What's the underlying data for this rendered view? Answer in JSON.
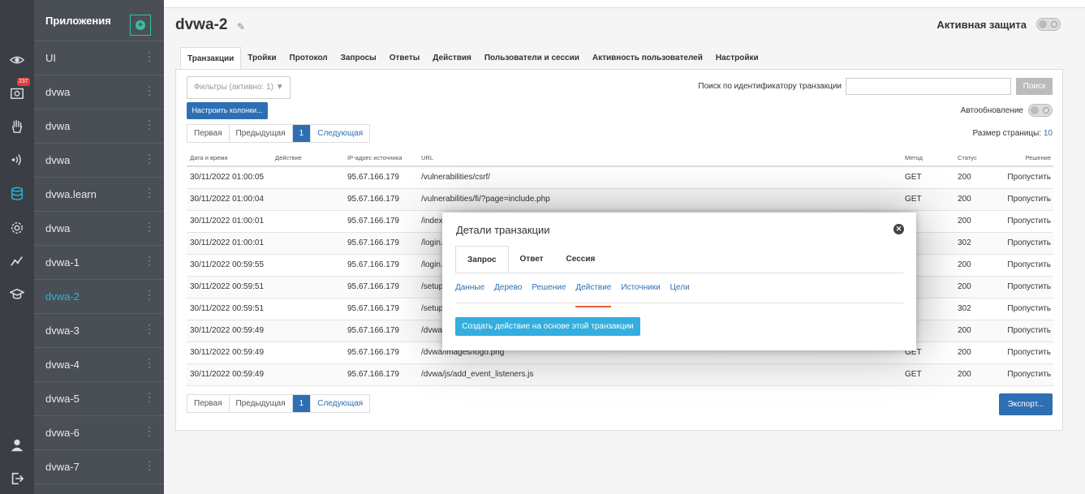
{
  "sidebar": {
    "badge": "237",
    "icons": [
      "eye-icon",
      "camera-icon",
      "hand-icon",
      "signal-icon",
      "database-icon",
      "gear-icon",
      "chart-icon",
      "graduation-icon",
      "user-icon",
      "logout-icon"
    ]
  },
  "apps": {
    "title": "Приложения",
    "items": [
      "UI",
      "dvwa",
      "dvwa",
      "dvwa",
      "dvwa.learn",
      "dvwa",
      "dvwa-1",
      "dvwa-2",
      "dvwa-3",
      "dvwa-4",
      "dvwa-5",
      "dvwa-6",
      "dvwa-7"
    ],
    "active_index": 7
  },
  "header": {
    "title": "dvwa-2",
    "protection_label": "Активная защита"
  },
  "tabs": [
    "Транзакции",
    "Тройки",
    "Протокол",
    "Запросы",
    "Ответы",
    "Действия",
    "Пользователи и сессии",
    "Активность пользователей",
    "Настройки"
  ],
  "toolbar": {
    "filter_label": "Фильтры (активно: 1) ▼",
    "search_label": "Поиск по идентификатору транзакции",
    "search_button": "Поиск",
    "configure_columns": "Настроить колонки...",
    "auto_refresh": "Автообновление",
    "page_size_label": "Размер страницы:",
    "page_size_value": "10",
    "export": "Экспорт..."
  },
  "pager": {
    "first": "Первая",
    "prev": "Предыдущая",
    "current": "1",
    "next": "Следующая"
  },
  "table": {
    "headers": [
      "Дата и время",
      "Действие",
      "IP-адрес источника",
      "URL",
      "Метод",
      "Статус",
      "Решение"
    ],
    "rows": [
      [
        "30/11/2022 01:00:05",
        "",
        "95.67.166.179",
        "/vulnerabilities/csrf/",
        "GET",
        "200",
        "Пропустить"
      ],
      [
        "30/11/2022 01:00:04",
        "",
        "95.67.166.179",
        "/vulnerabilities/fi/?page=include.php",
        "GET",
        "200",
        "Пропустить"
      ],
      [
        "30/11/2022 01:00:01",
        "",
        "95.67.166.179",
        "/index",
        "T",
        "200",
        "Пропустить"
      ],
      [
        "30/11/2022 01:00:01",
        "",
        "95.67.166.179",
        "/login.",
        "ST",
        "302",
        "Пропустить"
      ],
      [
        "30/11/2022 00:59:55",
        "",
        "95.67.166.179",
        "/login.",
        "T",
        "200",
        "Пропустить"
      ],
      [
        "30/11/2022 00:59:51",
        "",
        "95.67.166.179",
        "/setup",
        "T",
        "200",
        "Пропустить"
      ],
      [
        "30/11/2022 00:59:51",
        "",
        "95.67.166.179",
        "/setup",
        "ST",
        "302",
        "Пропустить"
      ],
      [
        "30/11/2022 00:59:49",
        "",
        "95.67.166.179",
        "/dvwa",
        "T",
        "200",
        "Пропустить"
      ],
      [
        "30/11/2022 00:59:49",
        "",
        "95.67.166.179",
        "/dvwa/images/logo.png",
        "GET",
        "200",
        "Пропустить"
      ],
      [
        "30/11/2022 00:59:49",
        "",
        "95.67.166.179",
        "/dvwa/js/add_event_listeners.js",
        "GET",
        "200",
        "Пропустить"
      ]
    ]
  },
  "modal": {
    "title": "Детали транзакции",
    "tabs": [
      "Запрос",
      "Ответ",
      "Сессия"
    ],
    "subtabs": [
      "Данные",
      "Дерево",
      "Решение",
      "Действие",
      "Источники",
      "Цели"
    ],
    "active_subtab": 3,
    "create_button": "Создать действие на основе этой транзакции"
  }
}
